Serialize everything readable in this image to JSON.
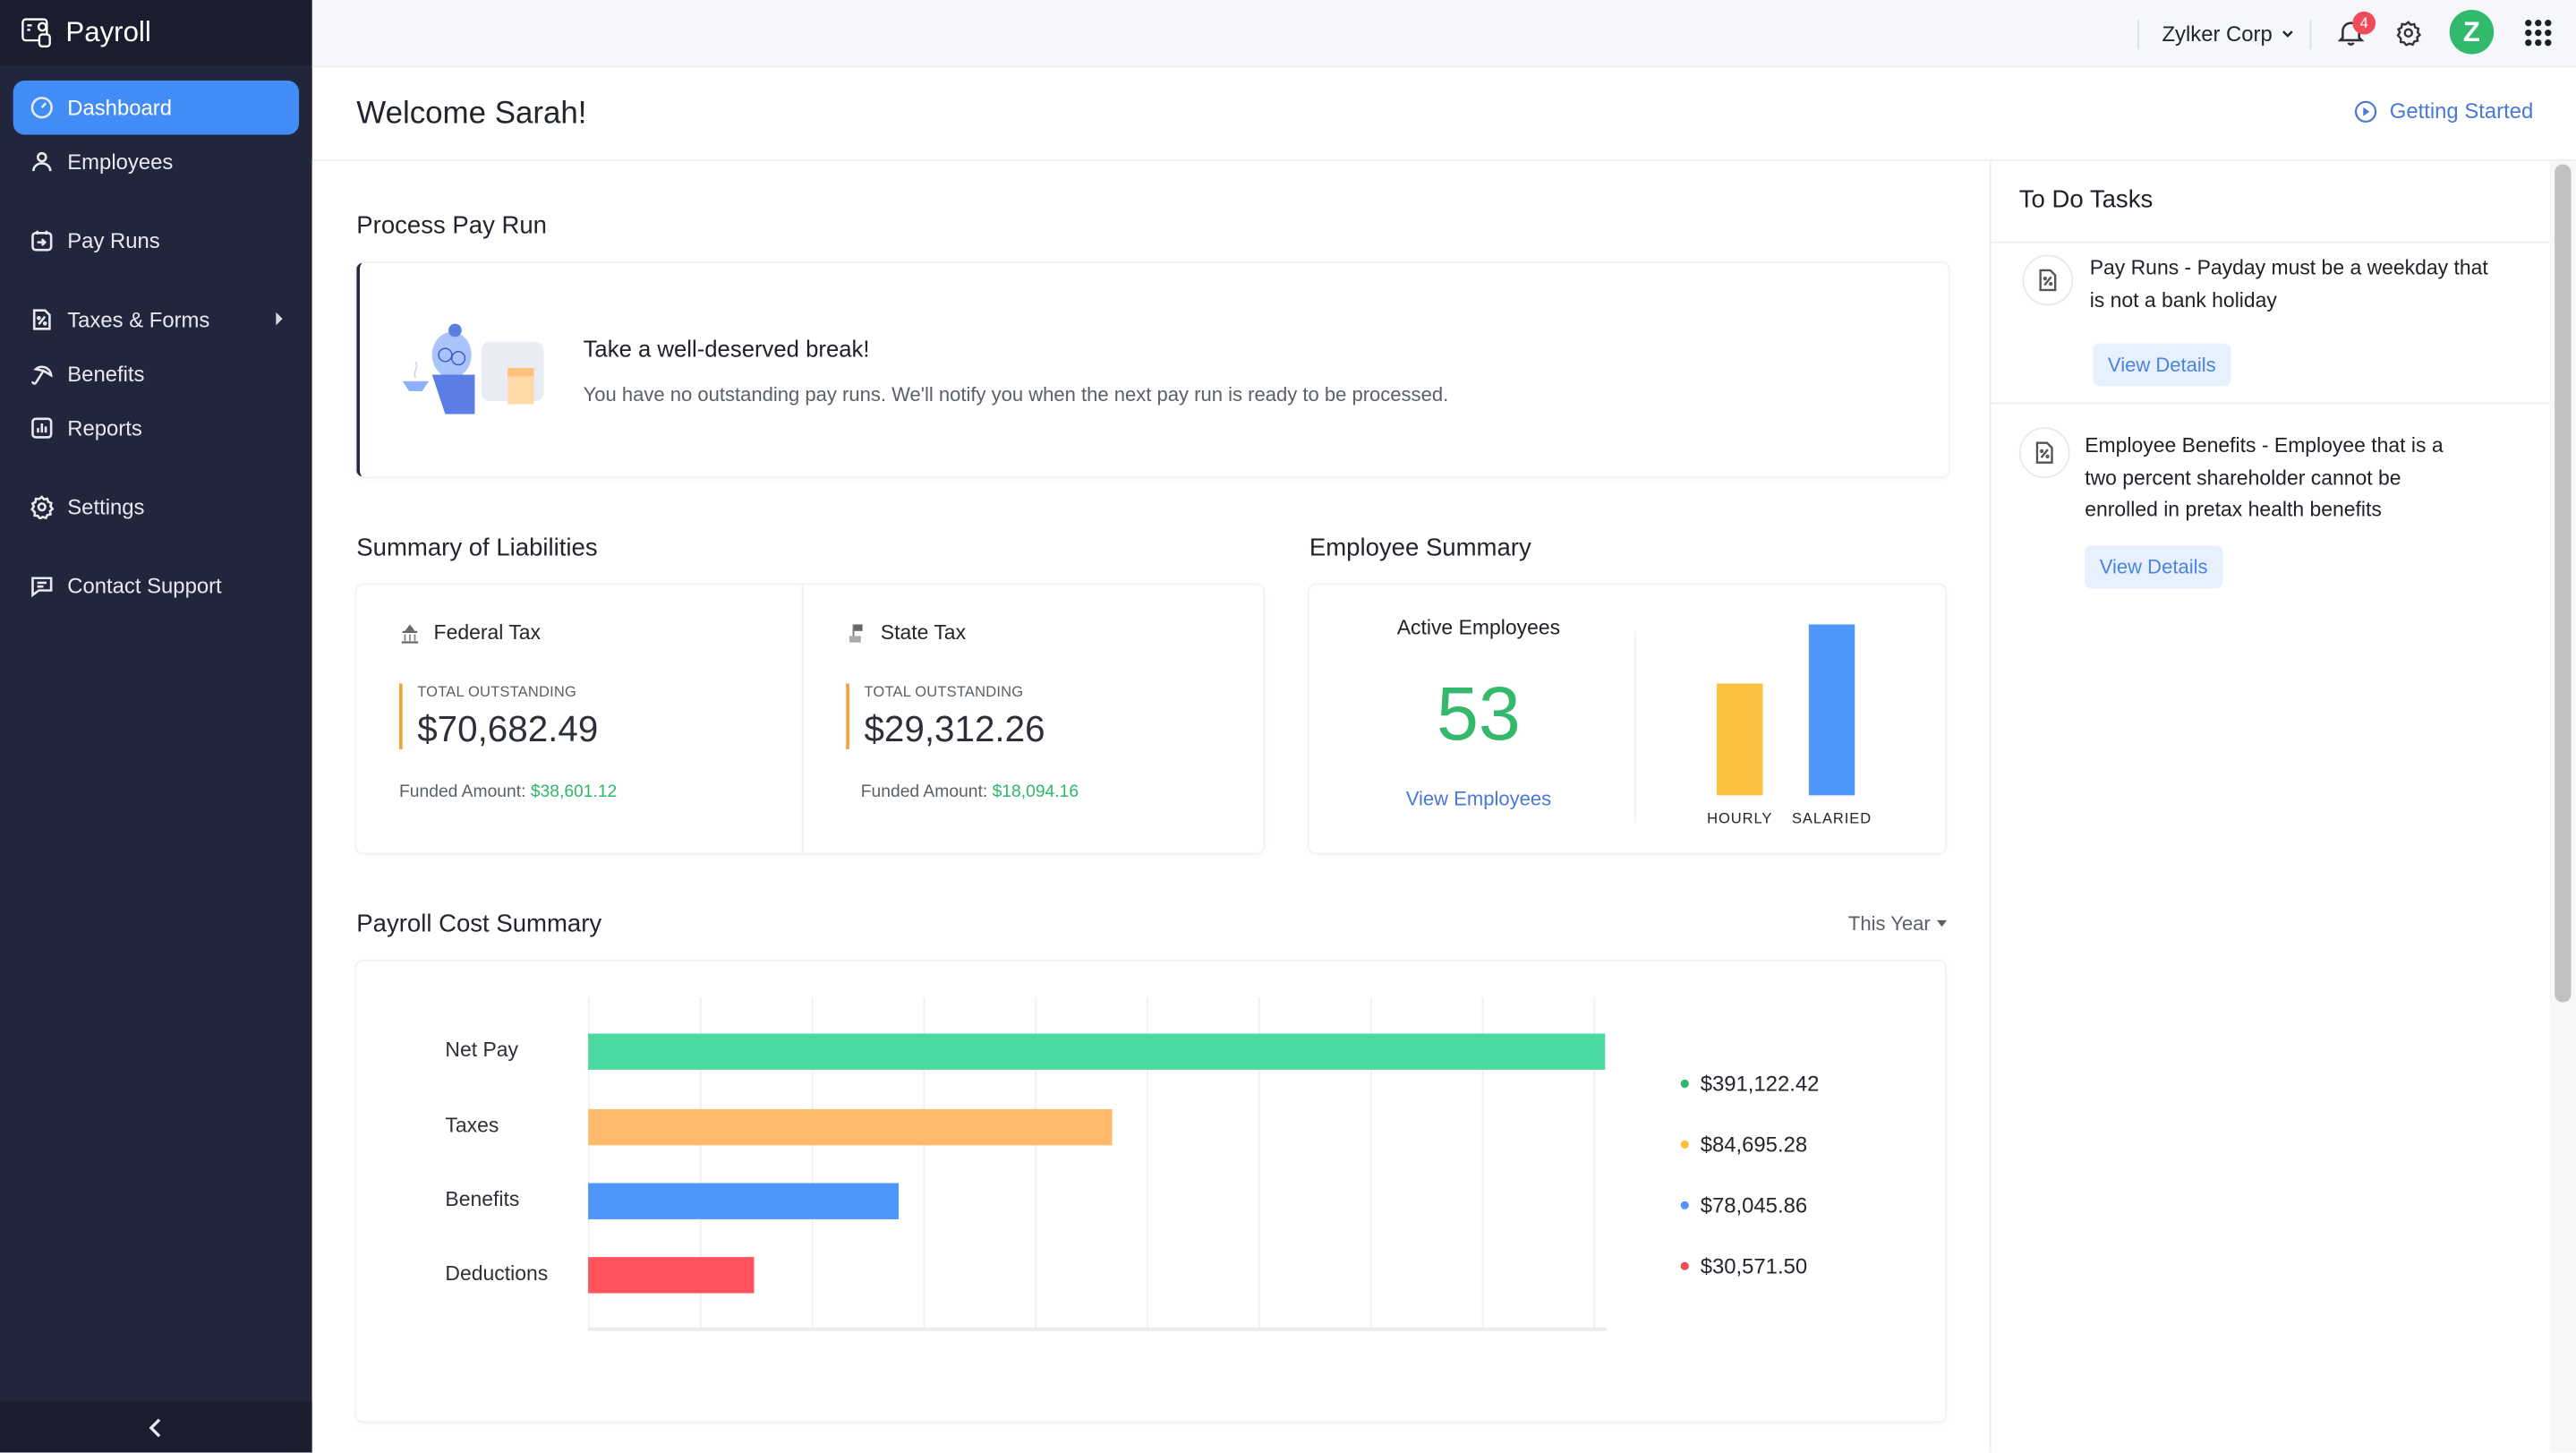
{
  "app": {
    "name": "Payroll"
  },
  "sidebar": {
    "items": [
      {
        "label": "Dashboard",
        "icon": "dashboard-gauge-icon",
        "active": true
      },
      {
        "label": "Employees",
        "icon": "person-icon"
      },
      {
        "label": "Pay Runs",
        "icon": "calendar-arrow-icon"
      },
      {
        "label": "Taxes & Forms",
        "icon": "percent-document-icon",
        "has_submenu": true
      },
      {
        "label": "Benefits",
        "icon": "umbrella-icon"
      },
      {
        "label": "Reports",
        "icon": "bar-chart-icon"
      },
      {
        "label": "Settings",
        "icon": "gear-icon"
      },
      {
        "label": "Contact Support",
        "icon": "chat-icon"
      }
    ],
    "collapse_icon": "chevron-left-icon"
  },
  "topbar": {
    "organization": "Zylker Corp",
    "notification_count": "4",
    "avatar_letter": "Z",
    "avatar_color": "#32ba6c"
  },
  "header": {
    "welcome": "Welcome Sarah!",
    "getting_started": "Getting Started"
  },
  "process_pay_run": {
    "title": "Process Pay Run",
    "heading": "Take a well-deserved break!",
    "message": "You have no outstanding pay runs. We'll notify you when the next pay run is ready to be processed."
  },
  "liabilities": {
    "title": "Summary of Liabilities",
    "items": [
      {
        "name": "Federal Tax",
        "icon": "capitol-building-icon",
        "label": "TOTAL OUTSTANDING",
        "amount": "$70,682.49",
        "funded_label": "Funded Amount:",
        "funded_amount": "$38,601.12"
      },
      {
        "name": "State Tax",
        "icon": "state-flag-icon",
        "label": "TOTAL OUTSTANDING",
        "amount": "$29,312.26",
        "funded_label": "Funded Amount:",
        "funded_amount": "$18,094.16"
      }
    ]
  },
  "employee_summary": {
    "title": "Employee Summary",
    "active_label": "Active Employees",
    "active_count": "53",
    "view_link": "View Employees"
  },
  "payroll_cost": {
    "title": "Payroll Cost Summary",
    "period": "This Year"
  },
  "todo": {
    "title": "To Do Tasks",
    "tasks": [
      {
        "text": "Pay Runs - Payday must be a weekday that is not a bank holiday",
        "button": "View Details"
      },
      {
        "text": "Employee Benefits - Employee that is a two percent shareholder cannot be enrolled in pretax health benefits",
        "button": "View Details"
      }
    ]
  },
  "chart_data": [
    {
      "type": "bar",
      "orientation": "vertical",
      "title": "Employee Summary",
      "categories": [
        "HOURLY",
        "SALARIED"
      ],
      "values": [
        21,
        32
      ],
      "colors": [
        "#fbc13e",
        "#4f96fb"
      ],
      "note": "values estimated from bar heights; total matches 53 active employees"
    },
    {
      "type": "bar",
      "orientation": "horizontal",
      "title": "Payroll Cost Summary",
      "categories": [
        "Net Pay",
        "Taxes",
        "Benefits",
        "Deductions"
      ],
      "values": [
        391122.42,
        84695.28,
        78045.86,
        30571.5
      ],
      "value_labels": [
        "$391,122.42",
        "$84,695.28",
        "$78,045.86",
        "$30,571.50"
      ],
      "relative_bar_lengths": [
        1.0,
        0.515,
        0.306,
        0.163
      ],
      "colors": [
        "#4ad9a0",
        "#ffbb6b",
        "#4f96fb",
        "#ff525d"
      ],
      "legend_dot_colors": [
        "#2fb768",
        "#fbc13e",
        "#4f96fb",
        "#ef4b5b"
      ],
      "grid": true,
      "legend": "right"
    }
  ]
}
